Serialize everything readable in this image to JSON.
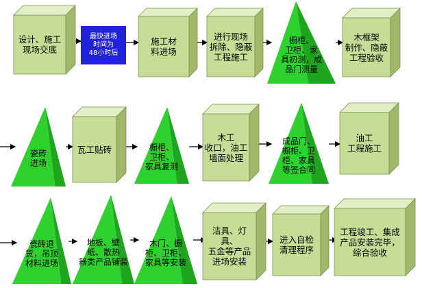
{
  "colors": {
    "box_front": "#c6dd95",
    "box_top": "#e2efc5",
    "box_side": "#9fb86a",
    "box_stroke": "#7a8f52",
    "pyramid_front": "#2fd12f",
    "pyramid_shade": "#1fa51f",
    "note_bg": "#2222dd",
    "arrow": "#000000"
  },
  "note": {
    "text": "最快进场\n时间为\n48小时后"
  },
  "steps": [
    {
      "id": "s1",
      "shape": "box",
      "label": "设计、施工\n现场交底"
    },
    {
      "id": "s2",
      "shape": "box",
      "label": "施工材\n料进场"
    },
    {
      "id": "s3",
      "shape": "box",
      "label": "进行现场\n拆除、隐蔽\n工程施工"
    },
    {
      "id": "s4",
      "shape": "pyramid",
      "label": "橱柜、\n卫柜、家\n具初测，成\n品门测量"
    },
    {
      "id": "s5",
      "shape": "box",
      "label": "木框架\n制作、隐蔽\n工程验收"
    },
    {
      "id": "s6",
      "shape": "pyramid",
      "label": "瓷砖\n进场"
    },
    {
      "id": "s7",
      "shape": "box",
      "label": "瓦工贴砖"
    },
    {
      "id": "s8",
      "shape": "pyramid",
      "label": "橱柜、\n卫柜、\n家具复测"
    },
    {
      "id": "s9",
      "shape": "box",
      "label": "木工\n收口，油工\n墙面处理"
    },
    {
      "id": "s10",
      "shape": "pyramid",
      "label": "成品门、\n橱柜、卫\n柜、家具\n等签合同"
    },
    {
      "id": "s11",
      "shape": "box",
      "label": "油工\n工程施工"
    },
    {
      "id": "s12",
      "shape": "pyramid",
      "label": "瓷砖退\n货，吊顶\n材料进场"
    },
    {
      "id": "s13",
      "shape": "pyramid",
      "label": "地板、壁\n纸、散热\n器类产品铺装"
    },
    {
      "id": "s14",
      "shape": "pyramid",
      "label": "木门、橱\n柜、卫柜、\n家具等安装"
    },
    {
      "id": "s15",
      "shape": "box",
      "label": "洁具、灯具、\n五金等产品\n进场安装"
    },
    {
      "id": "s16",
      "shape": "box",
      "label": "进入自检\n清理程序"
    },
    {
      "id": "s17",
      "shape": "box",
      "label": "工程竣工、集成\n产品安装完毕，\n综合验收"
    }
  ]
}
